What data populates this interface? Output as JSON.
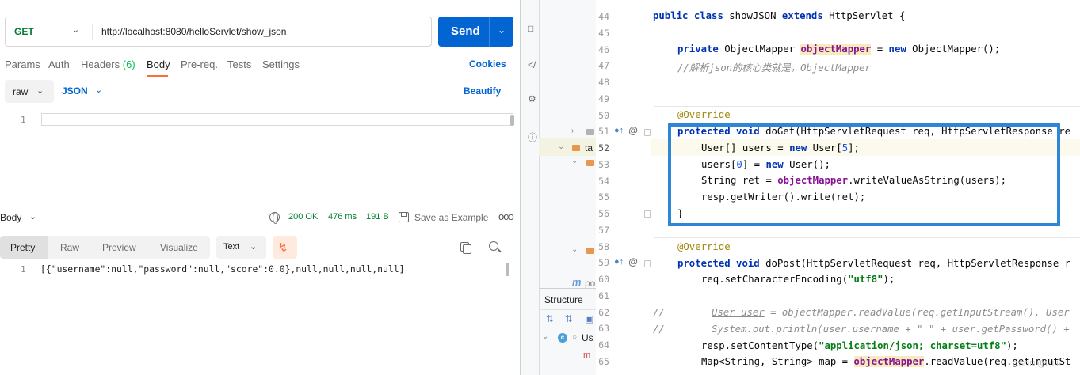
{
  "postman": {
    "method": "GET",
    "url": "http://localhost:8080/helloServlet/show_json",
    "send_label": "Send",
    "tabs": [
      {
        "label": "Params"
      },
      {
        "label": "Auth"
      },
      {
        "label": "Headers",
        "count": "(6)"
      },
      {
        "label": "Body",
        "active": true
      },
      {
        "label": "Pre-req."
      },
      {
        "label": "Tests"
      },
      {
        "label": "Settings"
      }
    ],
    "cookies_label": "Cookies",
    "body_type": "raw",
    "body_format": "JSON",
    "beautify_label": "Beautify",
    "request_line_number": "1",
    "response": {
      "section_label": "Body",
      "status": "200 OK",
      "time": "476 ms",
      "size": "191 B",
      "save_label": "Save as Example",
      "more_label": "ooo",
      "view_tabs": [
        "Pretty",
        "Raw",
        "Preview",
        "Visualize"
      ],
      "format": "Text",
      "line_number": "1",
      "body_text": "[{\"username\":null,\"password\":null,\"score\":0.0},null,null,null,null]"
    }
  },
  "ide": {
    "tree": {
      "item_ta": "ta",
      "item_mp": "m",
      "item_po": "po",
      "structure_label": "Structure",
      "struct_class": "Us",
      "struct_method": "m"
    },
    "line_numbers": [
      "44",
      "45",
      "46",
      "47",
      "48",
      "49",
      "50",
      "51",
      "52",
      "53",
      "54",
      "55",
      "56",
      "57",
      "58",
      "59",
      "60",
      "61",
      "62",
      "63",
      "64",
      "65"
    ],
    "code": {
      "l44_a": "public",
      "l44_b": "class",
      "l44_c": " showJSON ",
      "l44_d": "extends",
      "l44_e": " HttpServlet {",
      "l46_a": "private",
      "l46_b": " ObjectMapper ",
      "l46_c": "objectMapper",
      "l46_d": " = ",
      "l46_e": "new",
      "l46_f": " ObjectMapper();",
      "l47": "//解析json的核心类就是，ObjectMapper",
      "l50": "@Override",
      "l51_a": "protected",
      "l51_b": "void",
      "l51_c": " doGet(HttpServletRequest req, HttpServletResponse re",
      "l52_a": "User[] users = ",
      "l52_b": "new",
      "l52_c": " User[",
      "l52_d": "5",
      "l52_e": "];",
      "l53_a": "users[",
      "l53_b": "0",
      "l53_c": "] = ",
      "l53_d": "new",
      "l53_e": " User();",
      "l54_a": "String ret = ",
      "l54_b": "objectMapper",
      "l54_c": ".writeValueAsString(users);",
      "l55": "resp.getWriter().write(ret);",
      "l56": "}",
      "l58": "@Override",
      "l59_a": "protected",
      "l59_b": "void",
      "l59_c": " doPost(HttpServletRequest req, HttpServletResponse r",
      "l60_a": "req.setCharacterEncoding(",
      "l60_b": "\"utf8\"",
      "l60_c": ");",
      "l62_a": "//",
      "l62_b": "User user",
      "l62_c": " = objectMapper.readValue(req.getInputStream(), User",
      "l63_a": "//",
      "l63_b": "System.out.println(user.username + \" \" + user.getPassword() +",
      "l64_a": "resp.setContentType(",
      "l64_b": "\"application/json; charset=utf8\"",
      "l64_c": ");",
      "l65_a": "Map<String, String> map = ",
      "l65_b": "objectMapper",
      "l65_c": ".readValue(req.getInputSt"
    },
    "watermark": "CSDN @LILI..."
  }
}
